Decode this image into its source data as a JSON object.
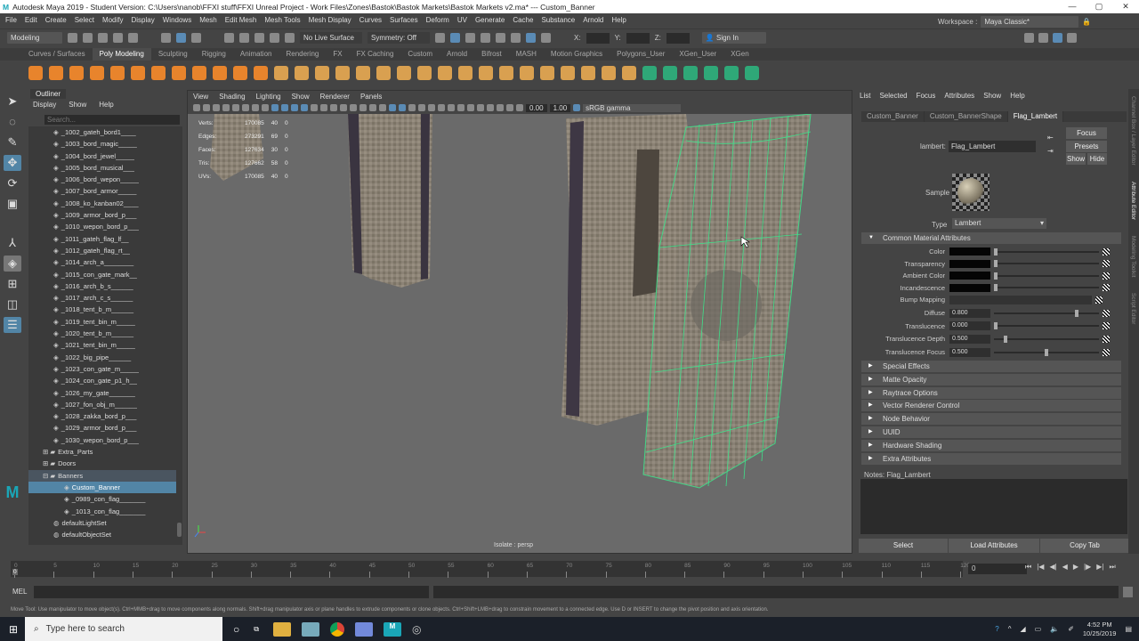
{
  "title": "Autodesk Maya 2019 - Student Version: C:\\Users\\nanob\\FFXI stuff\\FFXI Unreal Project - Work Files\\Zones\\Bastok\\Bastok Markets\\Bastok Markets v2.ma*  ---  Custom_Banner",
  "window_buttons": [
    "—",
    "▢",
    "✕"
  ],
  "menu": [
    "File",
    "Edit",
    "Create",
    "Select",
    "Modify",
    "Display",
    "Windows",
    "Mesh",
    "Edit Mesh",
    "Mesh Tools",
    "Mesh Display",
    "Curves",
    "Surfaces",
    "Deform",
    "UV",
    "Generate",
    "Cache",
    "Substance",
    "Arnold",
    "Help"
  ],
  "status": {
    "mode": "Modeling",
    "live_surface": "No Live Surface",
    "symmetry": "Symmetry: Off",
    "x": "X:",
    "y": "Y:",
    "z": "Z:",
    "sign_in": "Sign In",
    "workspace_label": "Workspace :",
    "workspace": "Maya Classic*"
  },
  "shelf_tabs": [
    "Curves / Surfaces",
    "Poly Modeling",
    "Sculpting",
    "Rigging",
    "Animation",
    "Rendering",
    "FX",
    "FX Caching",
    "Custom",
    "Arnold",
    "Bifrost",
    "MASH",
    "Motion Graphics",
    "Polygons_User",
    "XGen_User",
    "XGen"
  ],
  "shelf_active": "Poly Modeling",
  "outliner": {
    "tab": "Outliner",
    "menus": [
      "Display",
      "Show",
      "Help"
    ],
    "search_placeholder": "Search...",
    "items": [
      {
        "label": "_1002_gateh_bord1____",
        "indent": 2
      },
      {
        "label": "_1003_bord_magic_____",
        "indent": 2
      },
      {
        "label": "_1004_bord_jewel_____",
        "indent": 2
      },
      {
        "label": "_1005_bord_musical___",
        "indent": 2
      },
      {
        "label": "_1006_bord_wepon_____",
        "indent": 2
      },
      {
        "label": "_1007_bord_armor_____",
        "indent": 2
      },
      {
        "label": "_1008_ko_kanban02____",
        "indent": 2
      },
      {
        "label": "_1009_armor_bord_p___",
        "indent": 2
      },
      {
        "label": "_1010_wepon_bord_p___",
        "indent": 2
      },
      {
        "label": "_1011_gateh_flag_lf__",
        "indent": 2
      },
      {
        "label": "_1012_gateh_flag_rt__",
        "indent": 2
      },
      {
        "label": "_1014_arch_a________",
        "indent": 2
      },
      {
        "label": "_1015_con_gate_mark__",
        "indent": 2
      },
      {
        "label": "_1016_arch_b_s______",
        "indent": 2
      },
      {
        "label": "_1017_arch_c_s______",
        "indent": 2
      },
      {
        "label": "_1018_tent_b_m______",
        "indent": 2
      },
      {
        "label": "_1019_tent_bin_m_____",
        "indent": 2
      },
      {
        "label": "_1020_tent_b_m______",
        "indent": 2
      },
      {
        "label": "_1021_tent_bin_m_____",
        "indent": 2
      },
      {
        "label": "_1022_big_pipe______",
        "indent": 2
      },
      {
        "label": "_1023_con_gate_m_____",
        "indent": 2
      },
      {
        "label": "_1024_con_gate_p1_h__",
        "indent": 2
      },
      {
        "label": "_1026_my_gate_______",
        "indent": 2
      },
      {
        "label": "_1027_fon_obj_m______",
        "indent": 2
      },
      {
        "label": "_1028_zakka_bord_p___",
        "indent": 2
      },
      {
        "label": "_1029_armor_bord_p___",
        "indent": 2
      },
      {
        "label": "_1030_wepon_bord_p___",
        "indent": 2
      },
      {
        "label": "Extra_Parts",
        "indent": 1,
        "group": "⊞"
      },
      {
        "label": "Doors",
        "indent": 1,
        "group": "⊞"
      },
      {
        "label": "Banners",
        "indent": 1,
        "group": "⊟",
        "hl": true
      },
      {
        "label": "Custom_Banner",
        "indent": 3,
        "selected": true
      },
      {
        "label": "_0989_con_flag_______",
        "indent": 3
      },
      {
        "label": "_1013_con_flag_______",
        "indent": 3
      },
      {
        "label": "defaultLightSet",
        "indent": 2,
        "set": true
      },
      {
        "label": "defaultObjectSet",
        "indent": 2,
        "set": true
      }
    ]
  },
  "viewport": {
    "menus": [
      "View",
      "Shading",
      "Lighting",
      "Show",
      "Renderer",
      "Panels"
    ],
    "exposure": "0.00",
    "gamma": "1.00",
    "color_space": "sRGB gamma",
    "camera_label": "Isolate : persp",
    "hud": [
      [
        "Verts:",
        "170085",
        "40",
        "0"
      ],
      [
        "Edges:",
        "273291",
        "69",
        "0"
      ],
      [
        "Faces:",
        "127634",
        "30",
        "0"
      ],
      [
        "Tris:",
        "127662",
        "58",
        "0"
      ],
      [
        "UVs:",
        "170085",
        "40",
        "0"
      ]
    ]
  },
  "attr": {
    "menus": [
      "List",
      "Selected",
      "Focus",
      "Attributes",
      "Show",
      "Help"
    ],
    "tabs": [
      "Custom_Banner",
      "Custom_BannerShape",
      "Flag_Lambert"
    ],
    "active_tab": "Flag_Lambert",
    "node_label": "lambert:",
    "node_name": "Flag_Lambert",
    "focus": "Focus",
    "presets": "Presets",
    "show": "Show",
    "hide": "Hide",
    "sample": "Sample",
    "type_label": "Type",
    "type": "Lambert",
    "common": "Common Material Attributes",
    "colors": [
      {
        "label": "Color",
        "slider": 0
      },
      {
        "label": "Transparency",
        "slider": 0
      },
      {
        "label": "Ambient Color",
        "slider": 0
      },
      {
        "label": "Incandescence",
        "slider": 0
      }
    ],
    "bump": "Bump Mapping",
    "numeric": [
      {
        "label": "Diffuse",
        "value": "0.800",
        "slider": 0.8
      },
      {
        "label": "Translucence",
        "value": "0.000",
        "slider": 0
      },
      {
        "label": "Translucence Depth",
        "value": "0.500",
        "slider": 0.1
      },
      {
        "label": "Translucence Focus",
        "value": "0.500",
        "slider": 0.5
      }
    ],
    "sections": [
      "Special Effects",
      "Matte Opacity",
      "Raytrace Options",
      "Vector Renderer Control",
      "Node Behavior",
      "UUID",
      "Hardware Shading",
      "Extra Attributes"
    ],
    "notes": "Notes:  Flag_Lambert",
    "buttons": [
      "Select",
      "Load Attributes",
      "Copy Tab"
    ]
  },
  "side_tabs": [
    "Channel Box / Layer Editor",
    "Attribute Editor",
    "Modeling Toolkit",
    "Script Editor"
  ],
  "timeline": {
    "ticks": [
      "0",
      "5",
      "10",
      "15",
      "20",
      "25",
      "30",
      "35",
      "40",
      "45",
      "50",
      "55",
      "60",
      "65",
      "70",
      "75",
      "80",
      "85",
      "90",
      "95",
      "100",
      "105",
      "110",
      "115",
      "120"
    ],
    "current": "0",
    "frame_field": "0",
    "controls": [
      "⏮",
      "|◀",
      "◀|",
      "◀",
      "▶",
      "|▶",
      "▶|",
      "⏭"
    ]
  },
  "mel": "MEL",
  "help_line": "Move Tool: Use manipulator to move object(s). Ctrl+MMB+drag to move components along normals. Shift+drag manipulator axis or plane handles to extrude components or clone objects. Ctrl+Shift+LMB+drag to constrain movement to a connected edge. Use D or INSERT to change the pivot position and axis orientation.",
  "taskbar": {
    "search": "Type here to search",
    "time": "4:52 PM",
    "date": "10/25/2019"
  }
}
